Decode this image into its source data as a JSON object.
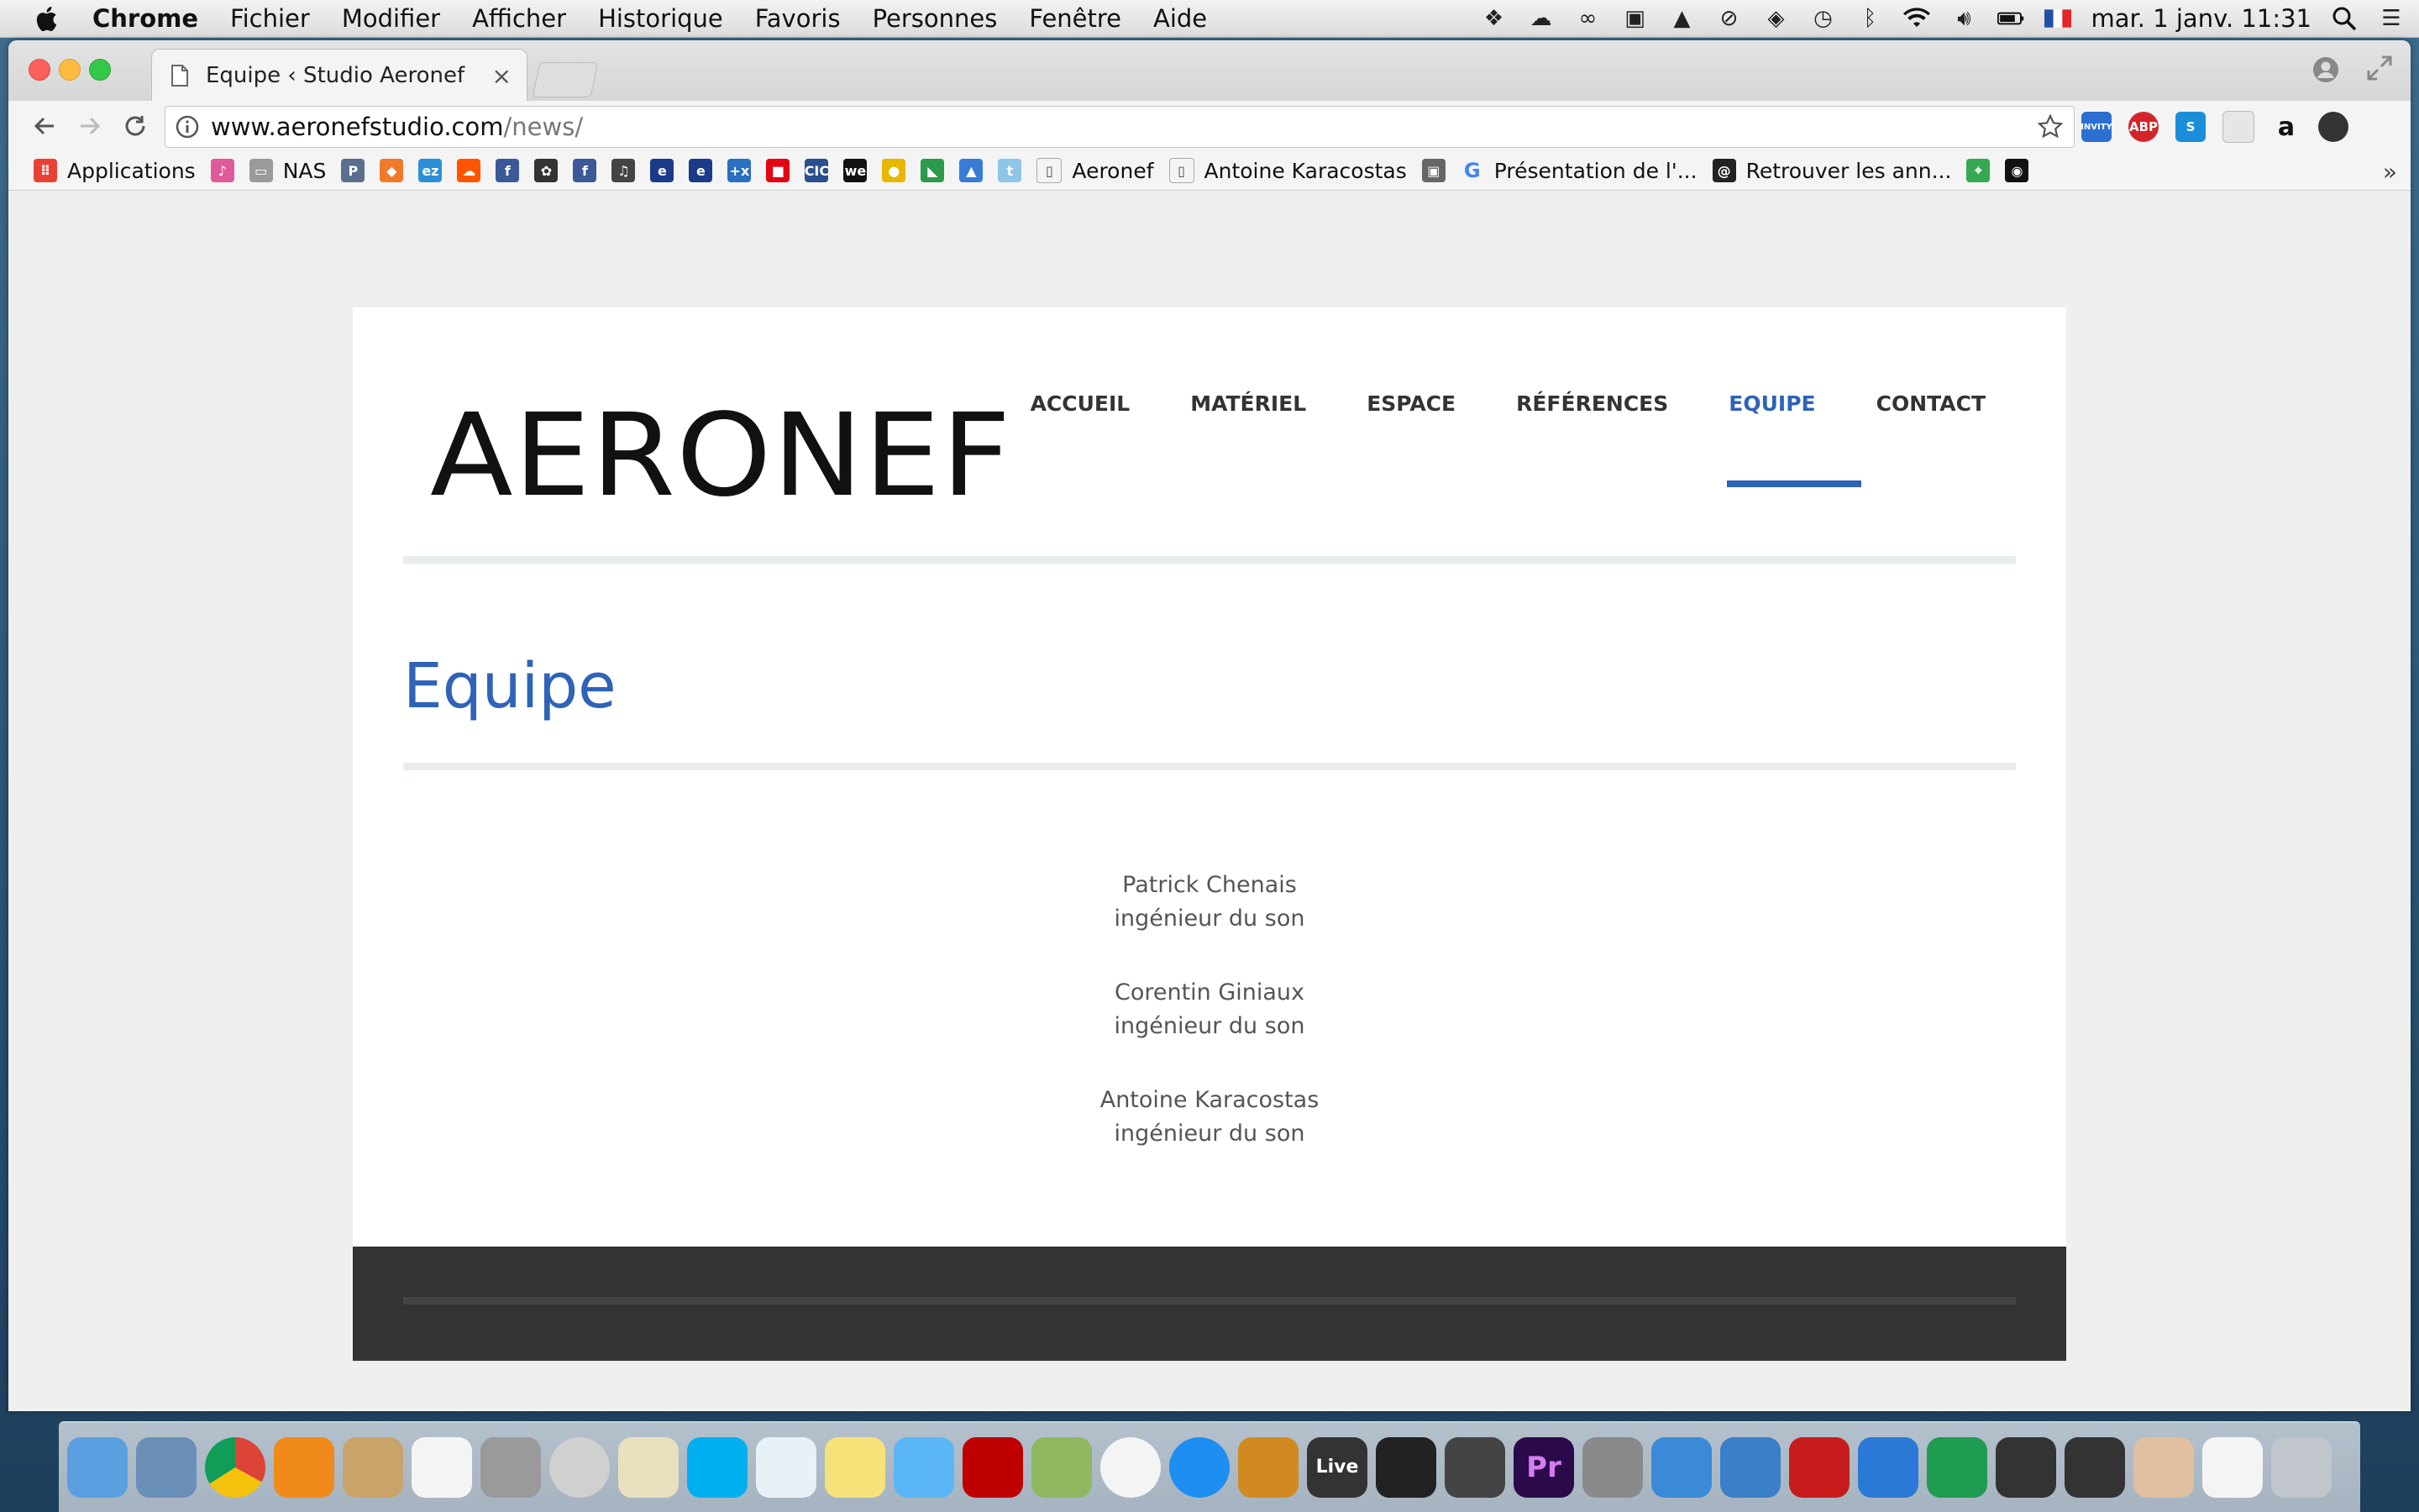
{
  "menubar": {
    "app": "Chrome",
    "menus": [
      "Fichier",
      "Modifier",
      "Afficher",
      "Historique",
      "Favoris",
      "Personnes",
      "Fenêtre",
      "Aide"
    ],
    "datetime": "mar. 1 janv.  11:31"
  },
  "tab": {
    "title": "Equipe ‹ Studio Aeronef",
    "close": "×"
  },
  "address": {
    "host": "www.aeronefstudio.com",
    "path": "/news/"
  },
  "bookmarks": [
    {
      "label": "Applications",
      "icon": "apps-grid-icon"
    },
    {
      "label": "",
      "icon": "bird-icon"
    },
    {
      "label": "NAS",
      "icon": "folder-icon"
    },
    {
      "label": "",
      "icon": "pss-icon"
    },
    {
      "label": "",
      "icon": "box-icon"
    },
    {
      "label": "",
      "icon": "ez-icon"
    },
    {
      "label": "",
      "icon": "soundcloud-icon"
    },
    {
      "label": "",
      "icon": "facebook-icon"
    },
    {
      "label": "",
      "icon": "flower-icon"
    },
    {
      "label": "",
      "icon": "facebook-icon"
    },
    {
      "label": "",
      "icon": "music-note-icon"
    },
    {
      "label": "",
      "icon": "eurosport-icon"
    },
    {
      "label": "",
      "icon": "eurosport-icon"
    },
    {
      "label": "",
      "icon": "plus-x-icon"
    },
    {
      "label": "",
      "icon": "bank-icon"
    },
    {
      "label": "",
      "icon": "cic-icon"
    },
    {
      "label": "",
      "icon": "wetransfer-icon"
    },
    {
      "label": "",
      "icon": "badge-icon"
    },
    {
      "label": "",
      "icon": "flag-icon"
    },
    {
      "label": "",
      "icon": "drive-icon"
    },
    {
      "label": "",
      "icon": "twitter-icon"
    },
    {
      "label": "Aeronef",
      "icon": "page-icon"
    },
    {
      "label": "Antoine Karacostas",
      "icon": "page-icon"
    },
    {
      "label": "",
      "icon": "photo-icon"
    },
    {
      "label": "Présentation de l'...",
      "icon": "google-icon"
    },
    {
      "label": "Retrouver les ann...",
      "icon": "at-icon"
    },
    {
      "label": "",
      "icon": "maps-icon"
    },
    {
      "label": "",
      "icon": "record-icon"
    }
  ],
  "extensions": [
    "INVITY",
    "ABP",
    "S",
    "",
    "a",
    ""
  ],
  "site": {
    "logo": "AERONEF",
    "nav": [
      "ACCUEIL",
      "MATÉRIEL",
      "ESPACE",
      "RÉFÉRENCES",
      "EQUIPE",
      "CONTACT"
    ],
    "active": "EQUIPE",
    "heading": "Equipe",
    "team": [
      {
        "name": "Patrick Chenais",
        "role": "ingénieur du son"
      },
      {
        "name": "Corentin Giniaux",
        "role": "ingénieur du son"
      },
      {
        "name": "Antoine Karacostas",
        "role": "ingénieur du son"
      }
    ],
    "accent": "#2e63b8"
  },
  "dock": [
    "Finder",
    "Mail",
    "Chrome",
    "VLC",
    "Contacts",
    "Calendar",
    "Calculator",
    "DVD",
    "Preview",
    "Skype",
    "TextEdit",
    "Notes",
    "Messages",
    "FileZilla",
    "iPhoto",
    "iTunes",
    "App Store",
    "GarageBand",
    "Live",
    "Logic",
    "Silent",
    "Premiere",
    "System Preferences",
    "Bird",
    "Transmit",
    "Acrobat",
    "Word",
    "Excel",
    "UA1",
    "UA2",
    "Photo",
    "Documents",
    "Trash"
  ],
  "dock_live_label": "Live",
  "dock_pr_label": "Pr"
}
